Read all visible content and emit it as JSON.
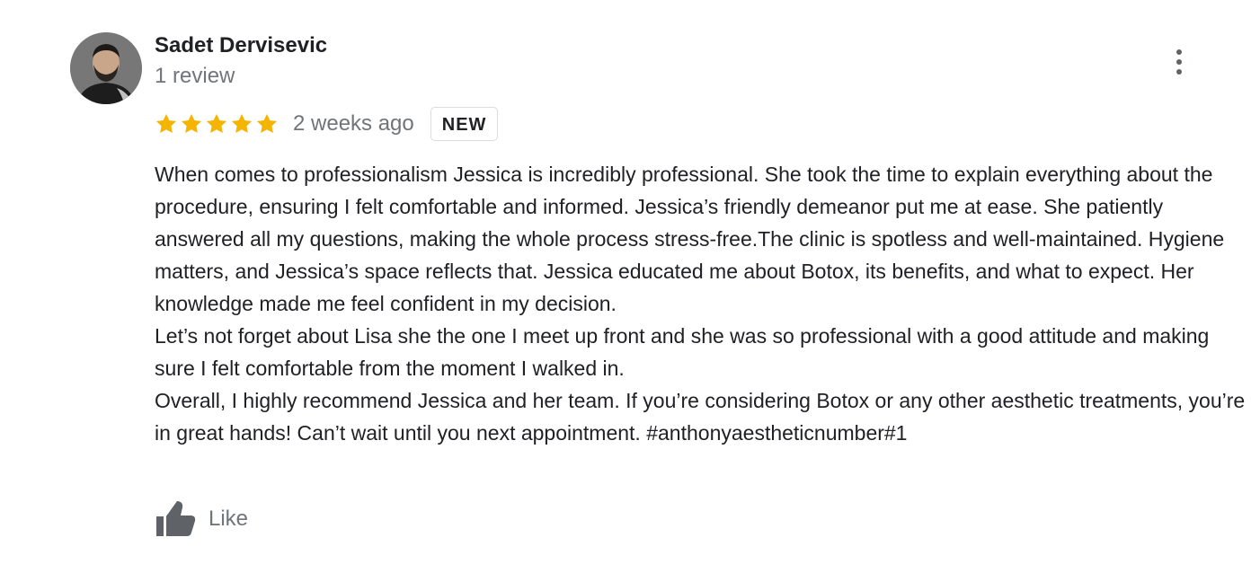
{
  "review": {
    "reviewer_name": "Sadet Dervisevic",
    "review_count": "1 review",
    "rating": 5,
    "max_rating": 5,
    "time_ago": "2 weeks ago",
    "badge": "NEW",
    "text": "When comes to professionalism Jessica is incredibly professional. She took the time to explain everything about the procedure, ensuring I felt comfortable and informed. Jessica’s friendly demeanor put me at ease. She patiently answered all my questions, making the whole process stress-free.The clinic is spotless and well-maintained. Hygiene matters, and Jessica’s space reflects that. Jessica educated me about Botox, its benefits, and what to expect. Her knowledge made me feel confident in my decision.\nLet’s not forget about Lisa she the one I meet up front and she was so professional with a good attitude and making sure I felt comfortable from the moment I walked in.\nOverall, I highly recommend Jessica and her team. If you’re considering Botox or any other aesthetic treatments, you’re in great hands! Can’t wait until you next appointment. #anthonyaestheticnumber#1",
    "like_label": "Like"
  },
  "icons": {
    "more": "more-vert-icon",
    "star": "star-icon",
    "like": "thumbs-up-icon"
  },
  "colors": {
    "star": "#f4b400",
    "name": "#202124",
    "secondary_text": "#70757a",
    "icon_gray": "#5f6368",
    "badge_border": "#dadce0"
  }
}
